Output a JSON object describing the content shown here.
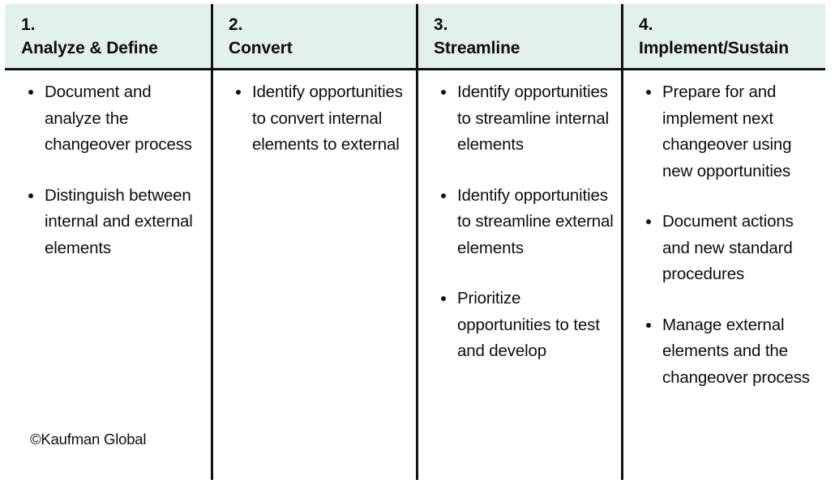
{
  "theme": {
    "header_bg": "#e2f1ee",
    "rule_color": "#111111",
    "text_color": "#0d0d0d",
    "page_bg": "#ffffff"
  },
  "columns": [
    {
      "number": "1.",
      "title": "Analyze & Define",
      "bullets": [
        "Document and analyze the changeover process",
        "Distinguish between internal and external elements"
      ],
      "footnote": "©Kaufman Global"
    },
    {
      "number": "2.",
      "title": "Convert",
      "bullets": [
        "Identify opportunities to convert internal elements to external"
      ]
    },
    {
      "number": "3.",
      "title": "Streamline",
      "bullets": [
        "Identify opportunities to streamline internal elements",
        "Identify opportunities to streamline external elements",
        "Prioritize opportunities to test and develop"
      ]
    },
    {
      "number": "4.",
      "title": "Implement/Sustain",
      "bullets": [
        "Prepare for and implement next changeover using new opportunities",
        "Document actions and new standard procedures",
        "Manage external elements and the changeover process"
      ]
    }
  ]
}
